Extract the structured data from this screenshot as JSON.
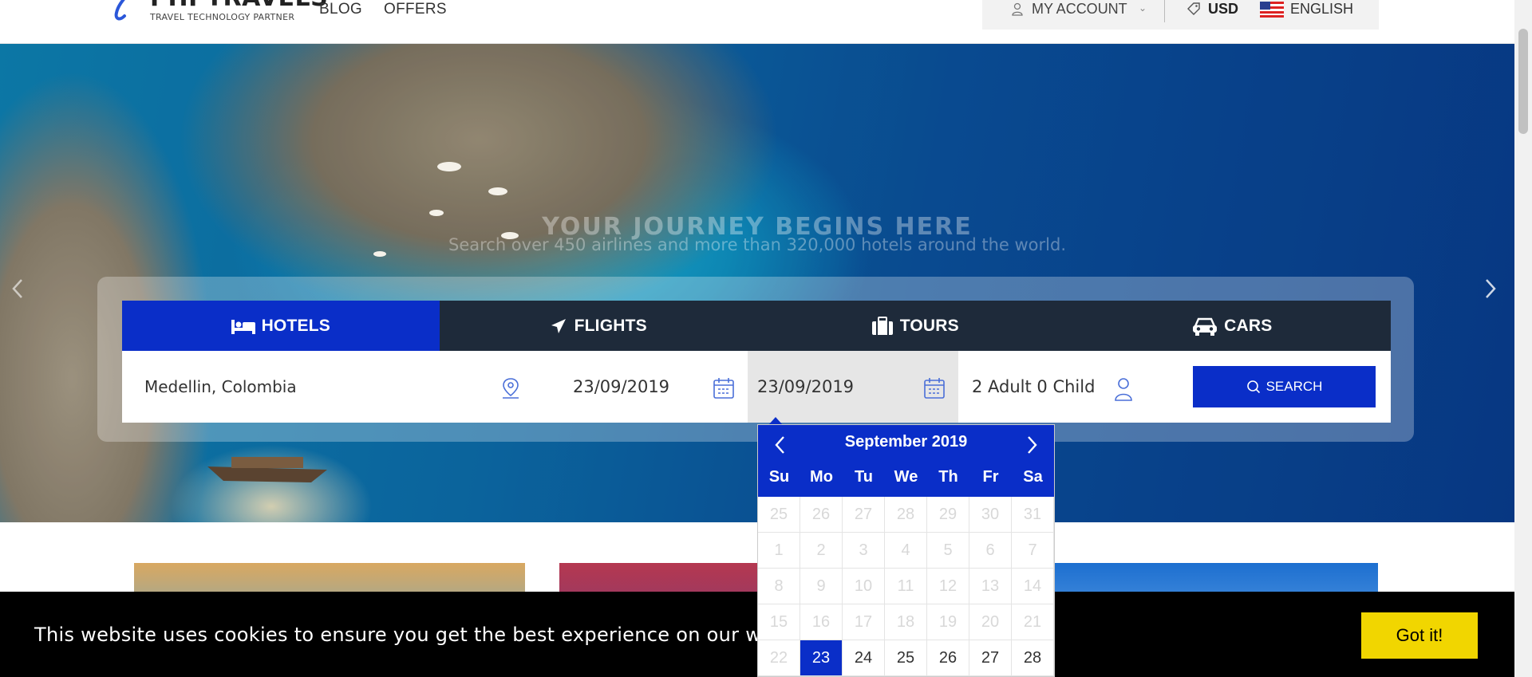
{
  "header": {
    "logo_text": "PHPTRAVELS",
    "logo_tagline": "TRAVEL TECHNOLOGY PARTNER",
    "nav": [
      "BLOG",
      "OFFERS"
    ],
    "account_label": "MY ACCOUNT",
    "currency": "USD",
    "language": "ENGLISH"
  },
  "hero": {
    "title": "YOUR JOURNEY BEGINS HERE",
    "subtitle": "Search over 450 airlines and more than 320,000 hotels around the world."
  },
  "tabs": [
    {
      "label": "HOTELS",
      "icon": "bed-icon",
      "active": true
    },
    {
      "label": "FLIGHTS",
      "icon": "plane-icon",
      "active": false
    },
    {
      "label": "TOURS",
      "icon": "suitcase-icon",
      "active": false
    },
    {
      "label": "CARS",
      "icon": "car-icon",
      "active": false
    }
  ],
  "search": {
    "location": "Medellin, Colombia",
    "checkin": "23/09/2019",
    "checkout": "23/09/2019",
    "guests": "2 Adult 0 Child",
    "button_label": "SEARCH"
  },
  "datepicker": {
    "month_label": "September 2019",
    "weekdays": [
      "Su",
      "Mo",
      "Tu",
      "We",
      "Th",
      "Fr",
      "Sa"
    ],
    "rows": [
      [
        "25",
        "26",
        "27",
        "28",
        "29",
        "30",
        "31"
      ],
      [
        "1",
        "2",
        "3",
        "4",
        "5",
        "6",
        "7"
      ],
      [
        "8",
        "9",
        "10",
        "11",
        "12",
        "13",
        "14"
      ],
      [
        "15",
        "16",
        "17",
        "18",
        "19",
        "20",
        "21"
      ],
      [
        "22",
        "23",
        "24",
        "25",
        "26",
        "27",
        "28"
      ]
    ],
    "selected_day": "23",
    "first_enabled_day": "23"
  },
  "cookie": {
    "text": "This website uses cookies to ensure you get the best experience on our websi",
    "button_label": "Got it!"
  },
  "colors": {
    "primary": "#0a2ec8",
    "tab_bar": "#1e2a3a",
    "cookie_bg": "#000000",
    "cookie_button": "#f1d600"
  }
}
